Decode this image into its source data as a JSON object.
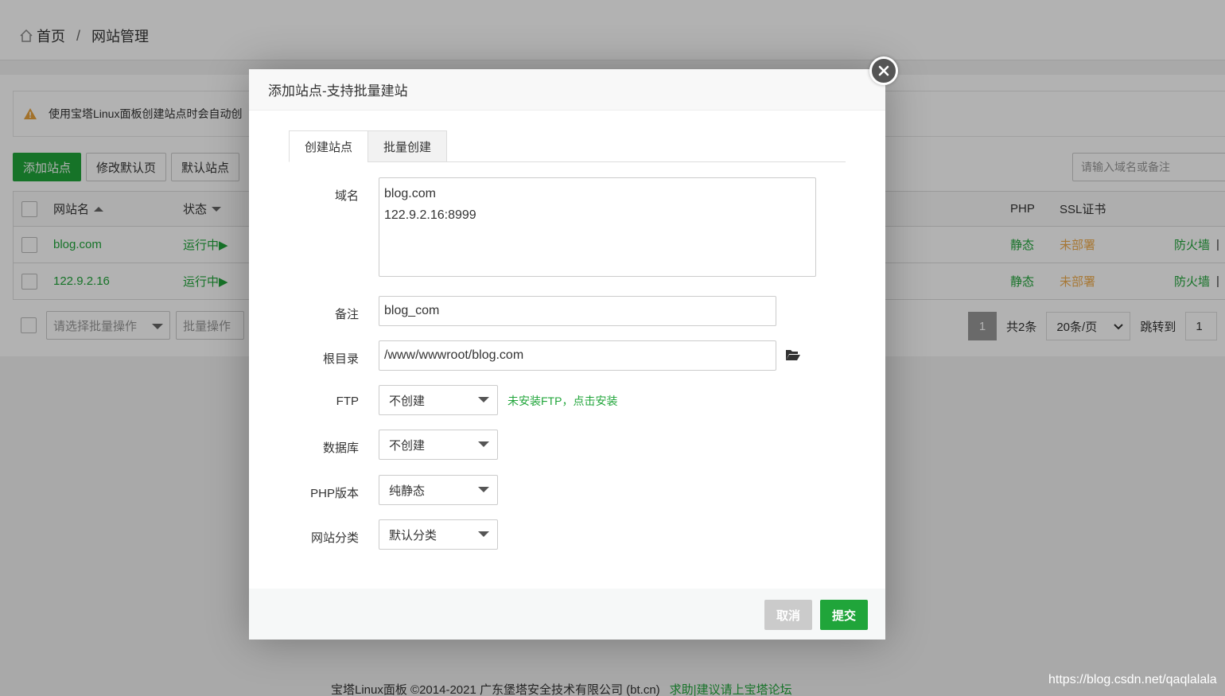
{
  "breadcrumb": {
    "home": "首页",
    "separator": "/",
    "current": "网站管理"
  },
  "alert": {
    "text": "使用宝塔Linux面板创建站点时会自动创"
  },
  "toolbar": {
    "add_site": "添加站点",
    "edit_default_page": "修改默认页",
    "default_site": "默认站点"
  },
  "search": {
    "placeholder": "请输入域名或备注"
  },
  "table": {
    "headers": {
      "name": "网站名",
      "status": "状态",
      "php": "PHP",
      "ssl": "SSL证书"
    },
    "rows": [
      {
        "name": "blog.com",
        "status": "运行中▶",
        "php": "静态",
        "ssl": "未部署",
        "action": "防火墙",
        "sep": "|"
      },
      {
        "name": "122.9.2.16",
        "status": "运行中▶",
        "php": "静态",
        "ssl": "未部署",
        "action": "防火墙",
        "sep": "|"
      }
    ]
  },
  "batch": {
    "select_placeholder": "请选择批量操作",
    "button": "批量操作"
  },
  "pager": {
    "current_page": "1",
    "total": "共2条",
    "per_page": "20条/页",
    "jump_label": "跳转到",
    "jump_value": "1"
  },
  "footer": {
    "copyright": "宝塔Linux面板 ©2014-2021 广东堡塔安全技术有限公司 (bt.cn)",
    "link": "求助|建议请上宝塔论坛"
  },
  "watermark": "https://blog.csdn.net/qaqlalala",
  "modal": {
    "title": "添加站点-支持批量建站",
    "tabs": [
      "创建站点",
      "批量创建"
    ],
    "fields": {
      "domain_label": "域名",
      "domain_lines": [
        "blog.com",
        "122.9.2.16:8999"
      ],
      "remark_label": "备注",
      "remark_value": "blog_com",
      "root_label": "根目录",
      "root_value": "/www/wwwroot/blog.com",
      "ftp_label": "FTP",
      "ftp_value": "不创建",
      "ftp_hint": "未安装FTP，点击安装",
      "db_label": "数据库",
      "db_value": "不创建",
      "php_label": "PHP版本",
      "php_value": "纯静态",
      "category_label": "网站分类",
      "category_value": "默认分类"
    },
    "buttons": {
      "cancel": "取消",
      "submit": "提交"
    }
  },
  "colors": {
    "accent": "#20a53a",
    "warning": "#f0ad4e",
    "overlay": "rgba(0,0,0,0.3)"
  }
}
